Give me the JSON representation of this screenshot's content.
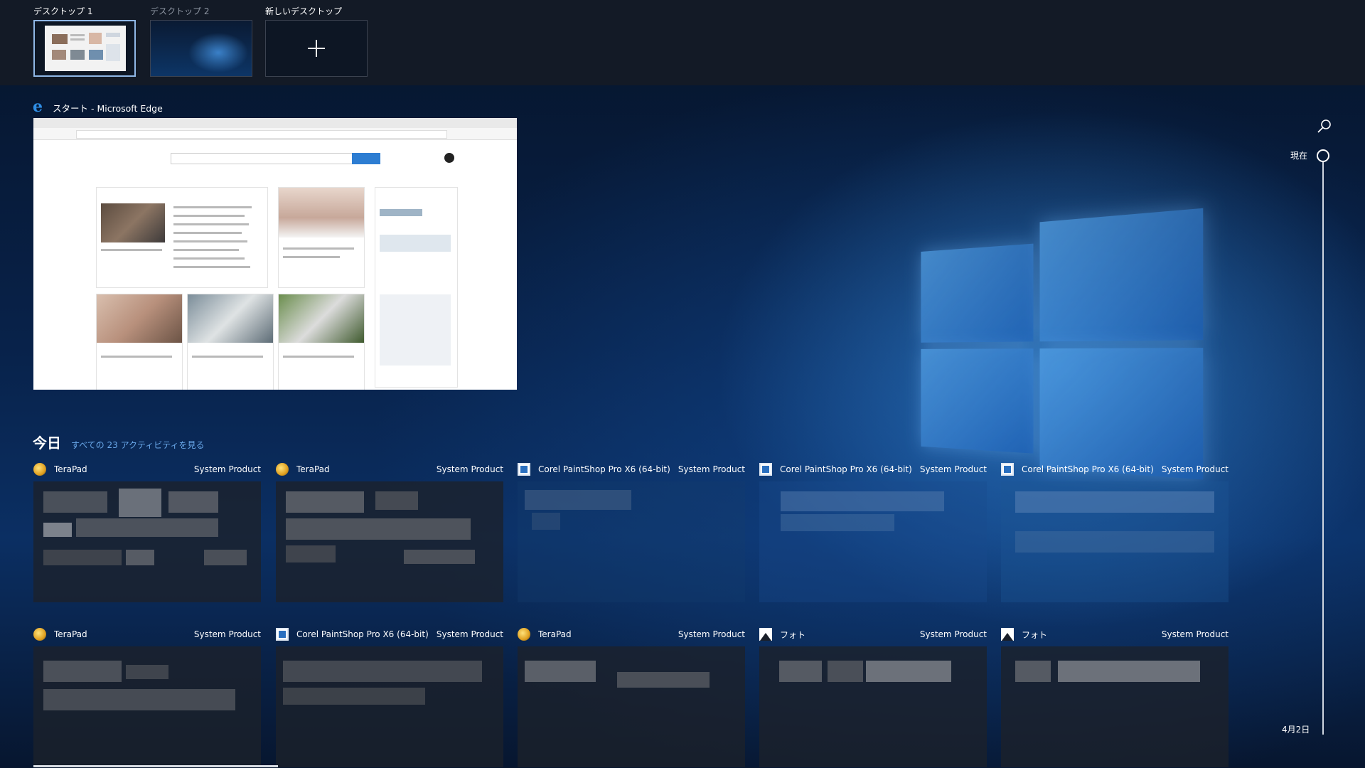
{
  "desktops": [
    {
      "label": "デスクトップ 1",
      "active": true
    },
    {
      "label": "デスクトップ 2",
      "active": false
    },
    {
      "label": "新しいデスクトップ",
      "active": false
    }
  ],
  "window": {
    "title": "スタート - Microsoft Edge",
    "icon": "edge-icon"
  },
  "timeline": {
    "section_title": "今日",
    "see_all": "すべての 23 アクティビティを見る",
    "now_label": "現在",
    "date_label": "4月2日",
    "activities": [
      {
        "app": "TeraPad",
        "device": "System Product",
        "icon": "terapad"
      },
      {
        "app": "TeraPad",
        "device": "System Product",
        "icon": "terapad"
      },
      {
        "app": "Corel PaintShop Pro X6 (64-bit)",
        "device": "System Product",
        "icon": "corel"
      },
      {
        "app": "Corel PaintShop Pro X6 (64-bit)",
        "device": "System Product",
        "icon": "corel"
      },
      {
        "app": "Corel PaintShop Pro X6 (64-bit)",
        "device": "System Product",
        "icon": "corel"
      },
      {
        "app": "TeraPad",
        "device": "System Product",
        "icon": "terapad"
      },
      {
        "app": "Corel PaintShop Pro X6 (64-bit)",
        "device": "System Product",
        "icon": "corel"
      },
      {
        "app": "TeraPad",
        "device": "System Product",
        "icon": "terapad"
      },
      {
        "app": "フォト",
        "device": "System Product",
        "icon": "photo"
      },
      {
        "app": "フォト",
        "device": "System Product",
        "icon": "photo"
      }
    ]
  },
  "colors": {
    "accent_link": "#6aa8ea",
    "active_border": "#8fb7e6",
    "strip_bg": "#131a26"
  }
}
